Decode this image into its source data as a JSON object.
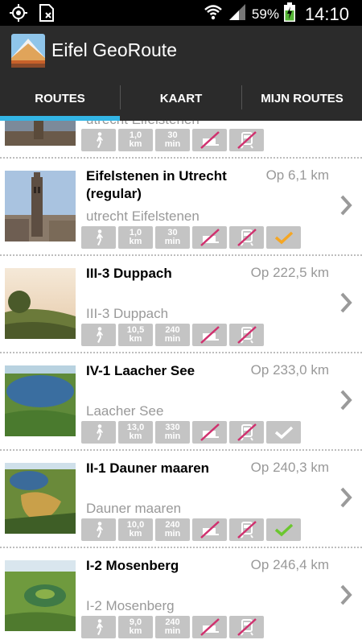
{
  "status": {
    "battery": "59%",
    "time": "14:10"
  },
  "app": {
    "title": "Eifel GeoRoute"
  },
  "tabs": [
    {
      "label": "ROUTES"
    },
    {
      "label": "KAART"
    },
    {
      "label": "MIJN ROUTES"
    }
  ],
  "routes": [
    {
      "title": "",
      "distance": "",
      "subtitle": "utrecht Eifelstenen",
      "km": "1,0",
      "km_unit": "km",
      "min": "30",
      "min_unit": "min",
      "done": "none"
    },
    {
      "title": "Eifelstenen in Utrecht (regular)",
      "distance": "Op 6,1 km",
      "subtitle": "utrecht Eifelstenen",
      "km": "1,0",
      "km_unit": "km",
      "min": "30",
      "min_unit": "min",
      "done": "orange"
    },
    {
      "title": "III-3 Duppach",
      "distance": "Op 222,5 km",
      "subtitle": "III-3 Duppach",
      "km": "10,5",
      "km_unit": "km",
      "min": "240",
      "min_unit": "min",
      "done": "none"
    },
    {
      "title": "IV-1 Laacher See",
      "distance": "Op 233,0 km",
      "subtitle": "Laacher See",
      "km": "13,0",
      "km_unit": "km",
      "min": "330",
      "min_unit": "min",
      "done": "white"
    },
    {
      "title": "II-1 Dauner maaren",
      "distance": "Op 240,3 km",
      "subtitle": "Dauner maaren",
      "km": "10,0",
      "km_unit": "km",
      "min": "240",
      "min_unit": "min",
      "done": "green"
    },
    {
      "title": "I-2 Mosenberg",
      "distance": "Op 246,4 km",
      "subtitle": "I-2 Mosenberg",
      "km": "9,0",
      "km_unit": "km",
      "min": "240",
      "min_unit": "min",
      "done": "none"
    }
  ],
  "colors": {
    "accent": "#33b5e5",
    "check_orange": "#f5a623",
    "check_green": "#6bc72f",
    "badge_gray": "#c4c4c4",
    "no_sign": "#d0306e"
  }
}
